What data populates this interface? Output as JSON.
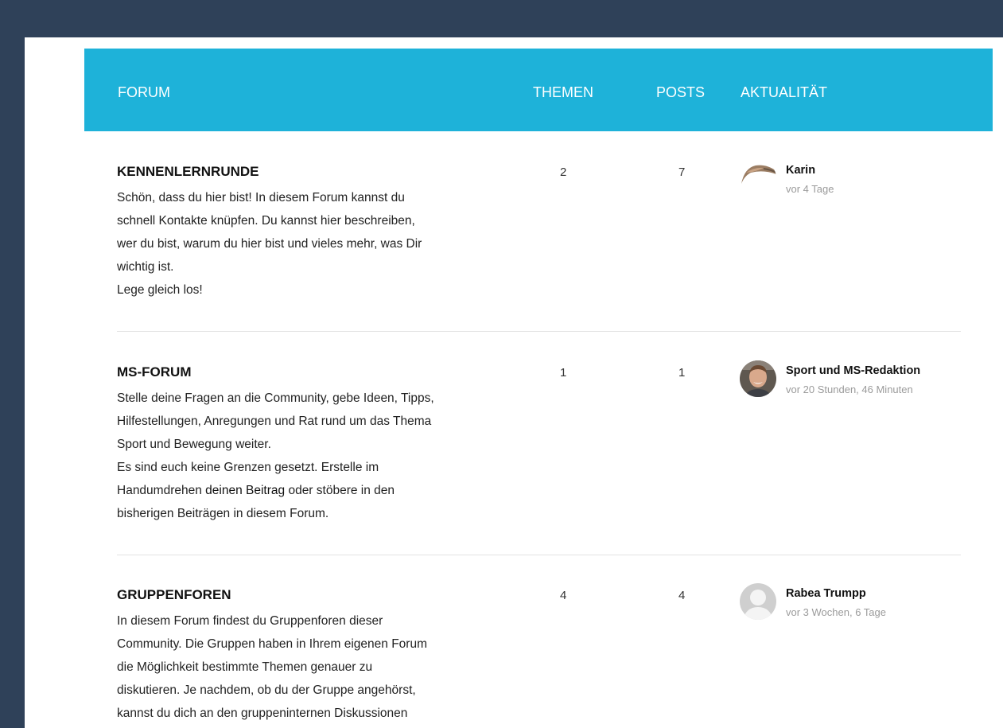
{
  "header": {
    "forum": "FORUM",
    "topics": "THEMEN",
    "posts": "POSTS",
    "activity": "AKTUALITÄT"
  },
  "forums": [
    {
      "title": "KENNENLERNRUNDE",
      "description": [
        "Schön, dass du hier bist! In diesem Forum kannst du",
        "schnell Kontakte knüpfen. Du kannst hier beschreiben,",
        "wer du bist, warum du hier bist und vieles mehr, was Dir",
        "wichtig ist.",
        "Lege gleich los!"
      ],
      "topics": "2",
      "posts": "7",
      "last_author": "Karin",
      "last_active": "vor 4 Tage"
    },
    {
      "title": "MS-FORUM",
      "description": [
        "Stelle deine Fragen an die Community, gebe Ideen, Tipps,",
        "Hilfestellungen, Anregungen und Rat rund um das Thema",
        "Sport und Bewegung weiter.",
        "Es sind euch keine Grenzen gesetzt. Erstelle im"
      ],
      "description_line5_prefix": "Handumdrehen ",
      "description_link": "deinen Beitrag",
      "description_line5_suffix": " oder stöbere in den",
      "description_line6": "bisherigen Beiträgen in diesem Forum.",
      "topics": "1",
      "posts": "1",
      "last_author": "Sport und MS-Redaktion",
      "last_active": "vor 20 Stunden, 46 Minuten"
    },
    {
      "title": "GRUPPENFOREN",
      "description": [
        "In diesem Forum findest du Gruppenforen dieser",
        "Community. Die Gruppen haben in Ihrem eigenen Forum",
        "die Möglichkeit bestimmte Themen genauer zu",
        "diskutieren. Je nachdem, ob du der Gruppe angehörst,",
        "kannst du dich an den gruppeninternen Diskussionen"
      ],
      "topics": "4",
      "posts": "4",
      "last_author": "Rabea Trumpp",
      "last_active": "vor 3 Wochen, 6 Tage"
    }
  ]
}
